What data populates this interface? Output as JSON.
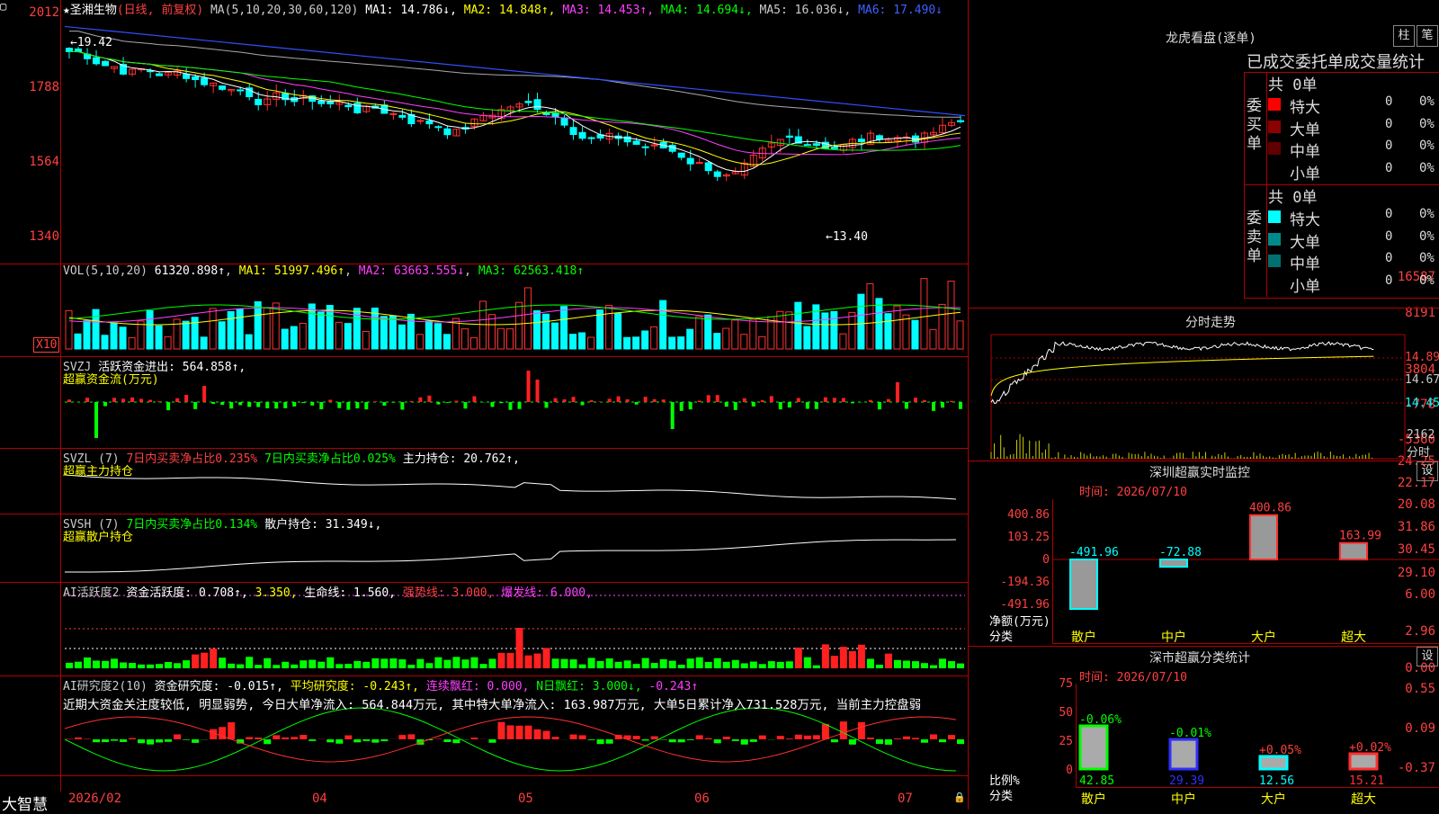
{
  "main": {
    "stock_name": "圣湘生物",
    "mode": "(日线, 前复权)",
    "ma_label": "MA(5,10,20,30,60,120)",
    "ma": [
      {
        "label": "MA1:",
        "value": "14.786↓",
        "color": "#ffffff"
      },
      {
        "label": "MA2:",
        "value": "14.848↑",
        "color": "#ffff00"
      },
      {
        "label": "MA3:",
        "value": "14.453↑",
        "color": "#ff40ff"
      },
      {
        "label": "MA4:",
        "value": "14.694↓",
        "color": "#00ff00"
      },
      {
        "label": "MA5:",
        "value": "16.036↓",
        "color": "#cccccc"
      },
      {
        "label": "MA6:",
        "value": "17.490↓",
        "color": "#4060ff"
      }
    ],
    "y_ticks": [
      "2012",
      "1788",
      "1564",
      "1340"
    ],
    "high_label": "←19.42",
    "low_label": "←13.40"
  },
  "vol": {
    "title": "VOL(5,10,20)",
    "value": "61320.898↑",
    "ma1": "MA1: 51997.496↑",
    "ma2": "MA2: 63663.555↓",
    "ma3": "MA3: 62563.418↑",
    "y_ticks": [
      "16587",
      "8191"
    ],
    "unit": "X10"
  },
  "svzj": {
    "title": "SVZJ",
    "text": "活跃资金进出: 564.858↑,",
    "sub": "超赢资金流(万元)",
    "y_ticks": [
      "3804",
      "-778",
      "-5360"
    ]
  },
  "svzl": {
    "title": "SVZL (7)",
    "a": "7日内买卖净占比0.235%",
    "b": "7日内买卖净占比0.025%",
    "c": "主力持仓: 20.762↑,",
    "sub": "超赢主力持仓",
    "y_ticks": [
      "24.25",
      "22.17",
      "20.08"
    ]
  },
  "svsh": {
    "title": "SVSH (7)",
    "a": "7日内买卖净占比0.134%",
    "b": "散户持仓: 31.349↓,",
    "sub": "超赢散户持仓",
    "y_ticks": [
      "31.86",
      "30.45",
      "29.10"
    ]
  },
  "ai1": {
    "title": "AI活跃度2",
    "a": "资金活跃度: 0.708↑,",
    "b": "3.350,",
    "c": "生命线: 1.560,",
    "d": "强势线: 3.000,",
    "e": "爆发线: 6.000,",
    "y_ticks": [
      "6.00",
      "2.96",
      "0.00"
    ]
  },
  "ai2": {
    "title": "AI研究度2(10)",
    "a": "资金研究度: -0.015↑,",
    "b": "平均研究度: -0.243↑,",
    "c": "连续飘红: 0.000,",
    "d": "N日飘红: 3.000↓,",
    "e": "-0.243↑",
    "comment": "近期大资金关注度较低, 明显弱势, 今日大单净流入: 564.844万元, 其中特大单净流入: 163.987万元, 大单5日累计净入731.528万元, 当前主力控盘弱",
    "y_ticks": [
      "0.55",
      "0.09",
      "-0.37"
    ]
  },
  "xaxis": {
    "labels": [
      "2026/02",
      "04",
      "05",
      "06",
      "07"
    ]
  },
  "brand": "大智慧",
  "right": {
    "lhb_title": "龙虎看盘(逐单)",
    "btn_zhu": "柱",
    "btn_bi": "笔",
    "stat_title": "已成交委托单成交量统计",
    "buy_side": "委买单",
    "sell_side": "委卖单",
    "buy_total": "共 0单",
    "sell_total": "共 0单",
    "rows": [
      {
        "name": "特大",
        "n": "0",
        "p": "0%"
      },
      {
        "name": "大单",
        "n": "0",
        "p": "0%"
      },
      {
        "name": "中单",
        "n": "0",
        "p": "0%"
      },
      {
        "name": "小单",
        "n": "0",
        "p": "0%"
      }
    ],
    "fenshi_title": "分时走势",
    "fenshi_y": [
      "14.89",
      "14.67",
      "14.45"
    ],
    "fenshi_vol": "2162",
    "fenshi_unit": "分时",
    "sz_title": "深圳超赢实时监控",
    "sz_btn": "设",
    "sz_time": "时间: 2026/07/10",
    "sz_y": [
      "400.86",
      "103.25",
      "0",
      "-194.36",
      "-491.96"
    ],
    "sz_unit": "净额(万元)",
    "sz_cat_label": "分类",
    "sz_bars": [
      {
        "cat": "散户",
        "value": -491.96,
        "label": "-491.96"
      },
      {
        "cat": "中户",
        "value": -72.88,
        "label": "-72.88"
      },
      {
        "cat": "大户",
        "value": 400.86,
        "label": "400.86"
      },
      {
        "cat": "超大",
        "value": 163.99,
        "label": "163.99"
      }
    ],
    "sc_title": "深市超赢分类统计",
    "sc_btn": "设",
    "sc_time": "时间: 2026/07/10",
    "sc_y": [
      "75",
      "50",
      "25",
      "0"
    ],
    "sc_unit": "比例%",
    "sc_cat_label": "分类",
    "sc_bars": [
      {
        "cat": "散户",
        "value": 42.85,
        "label": "-0.06%",
        "val_label": "42.85"
      },
      {
        "cat": "中户",
        "value": 29.39,
        "label": "-0.01%",
        "val_label": "29.39"
      },
      {
        "cat": "大户",
        "value": 12.56,
        "label": "+0.05%",
        "val_label": "12.56"
      },
      {
        "cat": "超大",
        "value": 15.21,
        "label": "+0.02%",
        "val_label": "15.21"
      }
    ]
  }
}
